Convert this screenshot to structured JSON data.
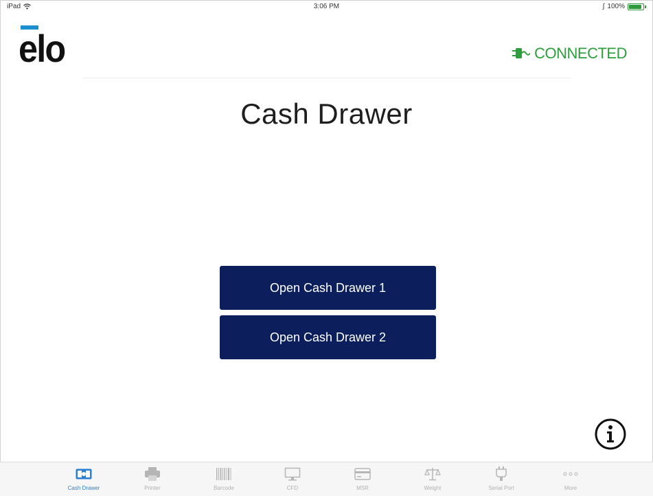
{
  "status_bar": {
    "device": "iPad",
    "time": "3:06 PM",
    "battery": "100%",
    "battery_level": 1.0
  },
  "header": {
    "logo": "elo",
    "connection_status": "CONNECTED"
  },
  "colors": {
    "accent": "#1d8fd1",
    "connected": "#2e9d3c",
    "button": "#0c1f5c",
    "tab_active": "#2b7fd3",
    "tab_inactive": "#b0b0b0"
  },
  "main": {
    "title": "Cash Drawer",
    "buttons": [
      {
        "label": "Open Cash Drawer 1"
      },
      {
        "label": "Open Cash Drawer 2"
      }
    ]
  },
  "tabs": [
    {
      "label": "Cash Drawer",
      "icon": "cash-drawer-icon",
      "active": true
    },
    {
      "label": "Printer",
      "icon": "printer-icon",
      "active": false
    },
    {
      "label": "Barcode",
      "icon": "barcode-icon",
      "active": false
    },
    {
      "label": "CFD",
      "icon": "monitor-icon",
      "active": false
    },
    {
      "label": "MSR",
      "icon": "card-icon",
      "active": false
    },
    {
      "label": "Weight",
      "icon": "scale-icon",
      "active": false
    },
    {
      "label": "Serial Port",
      "icon": "serial-port-icon",
      "active": false
    },
    {
      "label": "More",
      "icon": "more-icon",
      "active": false
    }
  ]
}
